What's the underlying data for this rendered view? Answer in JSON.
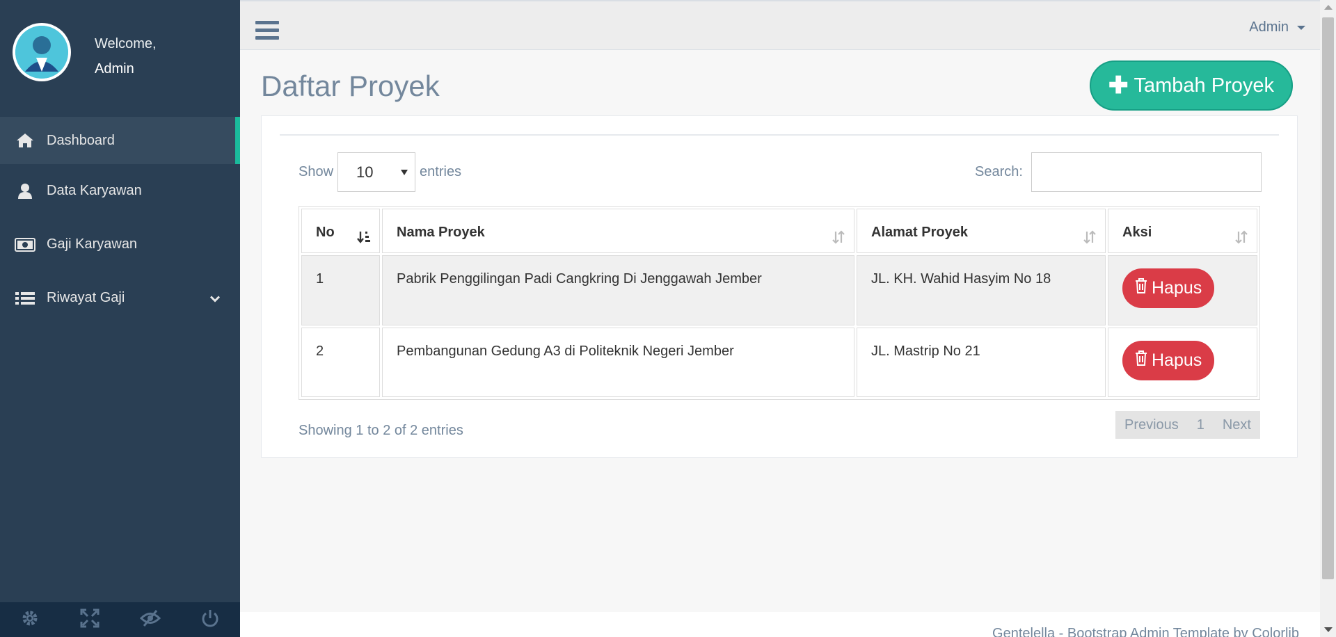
{
  "sidebar": {
    "welcome": "Welcome,",
    "user": "Admin",
    "items": [
      {
        "label": "Dashboard",
        "icon": "home-icon"
      },
      {
        "label": "Data Karyawan",
        "icon": "user-icon"
      },
      {
        "label": "Gaji Karyawan",
        "icon": "money-icon"
      },
      {
        "label": "Riwayat Gaji",
        "icon": "list-icon"
      }
    ]
  },
  "topnav": {
    "user": "Admin"
  },
  "page": {
    "title": "Daftar Proyek",
    "add_button": "Tambah Proyek"
  },
  "table_controls": {
    "show": "Show",
    "entries_value": "10",
    "entries": "entries",
    "search_label": "Search:"
  },
  "table": {
    "headers": [
      "No",
      "Nama Proyek",
      "Alamat Proyek",
      "Aksi"
    ],
    "rows": [
      {
        "no": "1",
        "nama": "Pabrik Penggilingan Padi Cangkring Di Jenggawah Jember",
        "alamat": "JL. KH. Wahid Hasyim No 18",
        "aksi": "Hapus"
      },
      {
        "no": "2",
        "nama": "Pembangunan Gedung A3 di Politeknik Negeri Jember",
        "alamat": "JL. Mastrip No 21",
        "aksi": "Hapus"
      }
    ]
  },
  "info": "Showing 1 to 2 of 2 entries",
  "pagination": {
    "previous": "Previous",
    "page": "1",
    "next": "Next"
  },
  "footer": "Gentelella - Bootstrap Admin Template by Colorlib",
  "colors": {
    "sidebar": "#2a3f54",
    "accent": "#1abb9c",
    "success": "#26b99a",
    "danger": "#da3c47"
  }
}
